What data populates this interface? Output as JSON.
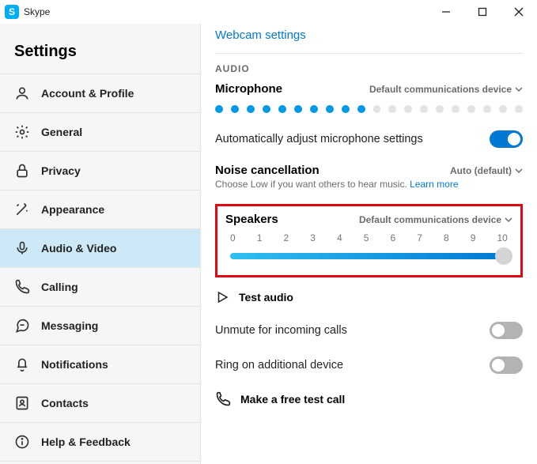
{
  "titlebar": {
    "app_name": "Skype",
    "app_initial": "S"
  },
  "sidebar": {
    "title": "Settings",
    "items": [
      {
        "label": "Account & Profile"
      },
      {
        "label": "General"
      },
      {
        "label": "Privacy"
      },
      {
        "label": "Appearance"
      },
      {
        "label": "Audio & Video"
      },
      {
        "label": "Calling"
      },
      {
        "label": "Messaging"
      },
      {
        "label": "Notifications"
      },
      {
        "label": "Contacts"
      },
      {
        "label": "Help & Feedback"
      }
    ]
  },
  "main": {
    "webcam_link": "Webcam settings",
    "audio_section": "AUDIO",
    "microphone": {
      "label": "Microphone",
      "device": "Default communications device",
      "level_on": 10,
      "level_total": 20
    },
    "auto_adjust": {
      "label": "Automatically adjust microphone settings",
      "on": true
    },
    "noise": {
      "label": "Noise cancellation",
      "value": "Auto (default)",
      "desc_a": "Choose Low if you want others to hear music. ",
      "learn": "Learn more"
    },
    "speakers": {
      "label": "Speakers",
      "device": "Default communications device",
      "ticks": [
        "0",
        "1",
        "2",
        "3",
        "4",
        "5",
        "6",
        "7",
        "8",
        "9",
        "10"
      ],
      "value": 10
    },
    "test_audio": "Test audio",
    "unmute": {
      "label": "Unmute for incoming calls",
      "on": false
    },
    "ring": {
      "label": "Ring on additional device",
      "on": false
    },
    "free_call": "Make a free test call"
  }
}
